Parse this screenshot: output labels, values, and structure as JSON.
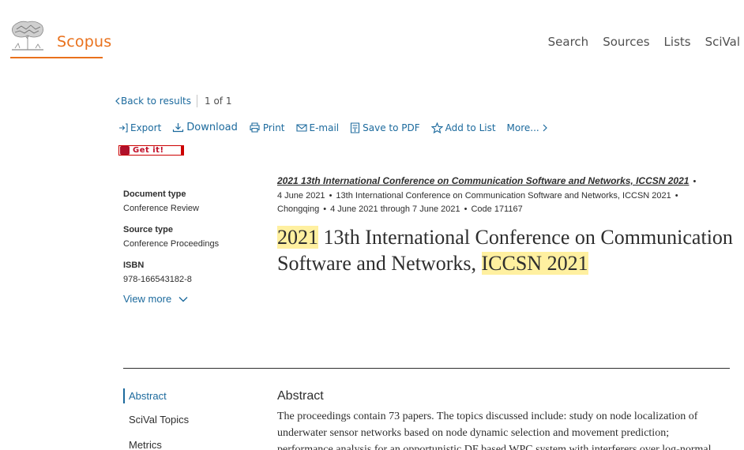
{
  "brand": {
    "name": "Scopus",
    "color": "#e9711c"
  },
  "topnav": [
    "Search",
    "Sources",
    "Lists",
    "SciVal"
  ],
  "backrow": {
    "back_label": "Back to results",
    "count": "1  of  1"
  },
  "toolbar": {
    "export": "Export",
    "download": "Download",
    "print": "Print",
    "email": "E-mail",
    "save_pdf": "Save to PDF",
    "add_list": "Add to List",
    "more": "More..."
  },
  "getit": {
    "label": "Get it!"
  },
  "meta": {
    "doc_type_label": "Document type",
    "doc_type": "Conference Review",
    "source_type_label": "Source type",
    "source_type": "Conference Proceedings",
    "isbn_label": "ISBN",
    "isbn": "978-166543182-8",
    "view_more": "View more"
  },
  "source": {
    "title": "2021 13th International Conference on Communication Software and Networks, ICCSN 2021",
    "date": "4 June 2021",
    "conference": "13th International Conference on Communication Software and Networks, ICCSN 2021",
    "location": "Chongqing",
    "dates_range": "4 June 2021 through 7 June 2021",
    "code": "Code 171167"
  },
  "title": {
    "part1": "2021",
    "part2": " 13th International Conference on Communication Software and Networks, ",
    "part3": "ICCSN 2021"
  },
  "sidenav": [
    "Abstract",
    "SciVal Topics",
    "Metrics"
  ],
  "abstract": {
    "heading": "Abstract",
    "text": "The proceedings contain 73 papers. The topics discussed include: study on node localization of underwater sensor networks based on node dynamic selection and movement prediction; performance analysis for an opportunistic DF based WPC system with interferers over log-normal"
  },
  "colors": {
    "link": "#1c6a9d",
    "highlight": "#fff0a0"
  }
}
